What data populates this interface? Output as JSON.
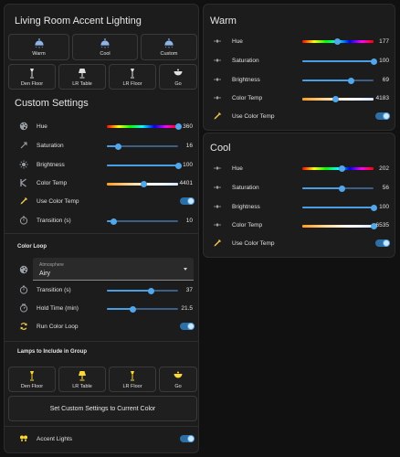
{
  "main": {
    "title": "Living Room Accent Lighting",
    "scenes": [
      {
        "label": "Warm",
        "icon": "ceiling-light-icon"
      },
      {
        "label": "Cool",
        "icon": "ceiling-light-icon"
      },
      {
        "label": "Custom",
        "icon": "ceiling-light-icon"
      }
    ],
    "lamps_top": [
      {
        "label": "Den Floor",
        "icon": "floor-lamp-icon"
      },
      {
        "label": "LR Table",
        "icon": "table-lamp-icon"
      },
      {
        "label": "LR Floor",
        "icon": "floor-lamp-icon"
      },
      {
        "label": "Go",
        "icon": "go-lamp-icon"
      }
    ]
  },
  "custom": {
    "title": "Custom Settings",
    "hue": {
      "label": "Hue",
      "value": "360",
      "level": 1.0
    },
    "saturation": {
      "label": "Saturation",
      "value": "16",
      "level": 0.16
    },
    "brightness": {
      "label": "Brightness",
      "value": "100",
      "level": 1.0
    },
    "color_temp": {
      "label": "Color Temp",
      "value": "4401",
      "level": 0.52
    },
    "use_color_temp": {
      "label": "Use Color Temp",
      "on": true
    },
    "transition": {
      "label": "Transition (s)",
      "value": "10",
      "level": 0.1
    },
    "color_loop": {
      "heading": "Color Loop",
      "select_label": "Atmosphere",
      "select_value": "Airy",
      "transition": {
        "label": "Transition (s)",
        "value": "37",
        "level": 0.62
      },
      "hold_time": {
        "label": "Hold Time (min)",
        "value": "21.5",
        "level": 0.36
      },
      "run": {
        "label": "Run Color Loop",
        "on": true
      }
    },
    "lamps_heading": "Lamps to Include in Group",
    "lamps": [
      {
        "label": "Den Floor",
        "icon": "floor-lamp-icon"
      },
      {
        "label": "LR Table",
        "icon": "table-lamp-icon"
      },
      {
        "label": "LR Floor",
        "icon": "floor-lamp-icon"
      },
      {
        "label": "Go",
        "icon": "go-lamp-icon"
      }
    ],
    "set_button": "Set Custom Settings to Current Color",
    "accent": {
      "label": "Accent Lights",
      "on": true
    }
  },
  "warm": {
    "title": "Warm",
    "hue": {
      "label": "Hue",
      "value": "177",
      "level": 0.49
    },
    "saturation": {
      "label": "Saturation",
      "value": "100",
      "level": 1.0
    },
    "brightness": {
      "label": "Brightness",
      "value": "69",
      "level": 0.69
    },
    "color_temp": {
      "label": "Color Temp",
      "value": "4183",
      "level": 0.47
    },
    "use_color_temp": {
      "label": "Use Color Temp",
      "on": true
    }
  },
  "cool": {
    "title": "Cool",
    "hue": {
      "label": "Hue",
      "value": "202",
      "level": 0.56
    },
    "saturation": {
      "label": "Saturation",
      "value": "56",
      "level": 0.56
    },
    "brightness": {
      "label": "Brightness",
      "value": "100",
      "level": 1.0
    },
    "color_temp": {
      "label": "Color Temp",
      "value": "6535",
      "level": 1.0
    },
    "use_color_temp": {
      "label": "Use Color Temp",
      "on": true
    }
  },
  "colors": {
    "accent": "#4a9ee3",
    "lamp_yellow": "#fdd835",
    "scene_blue": "#8fb4e8",
    "icon_gray": "#9aa0a6"
  }
}
